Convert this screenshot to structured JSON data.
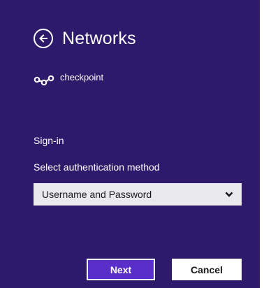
{
  "header": {
    "title": "Networks",
    "back_icon": "arrow-left-circle-icon"
  },
  "network": {
    "icon": "wifi-link-icon",
    "name": "checkpoint"
  },
  "signin": {
    "section_label": "Sign-in",
    "method_label": "Select authentication method",
    "selected_method": "Username and Password",
    "dropdown_icon": "chevron-down-icon"
  },
  "actions": {
    "next_label": "Next",
    "cancel_label": "Cancel"
  },
  "colors": {
    "background": "#2d1a6b",
    "primary_button": "#5a2ec9",
    "select_background": "#e9e9ee"
  }
}
